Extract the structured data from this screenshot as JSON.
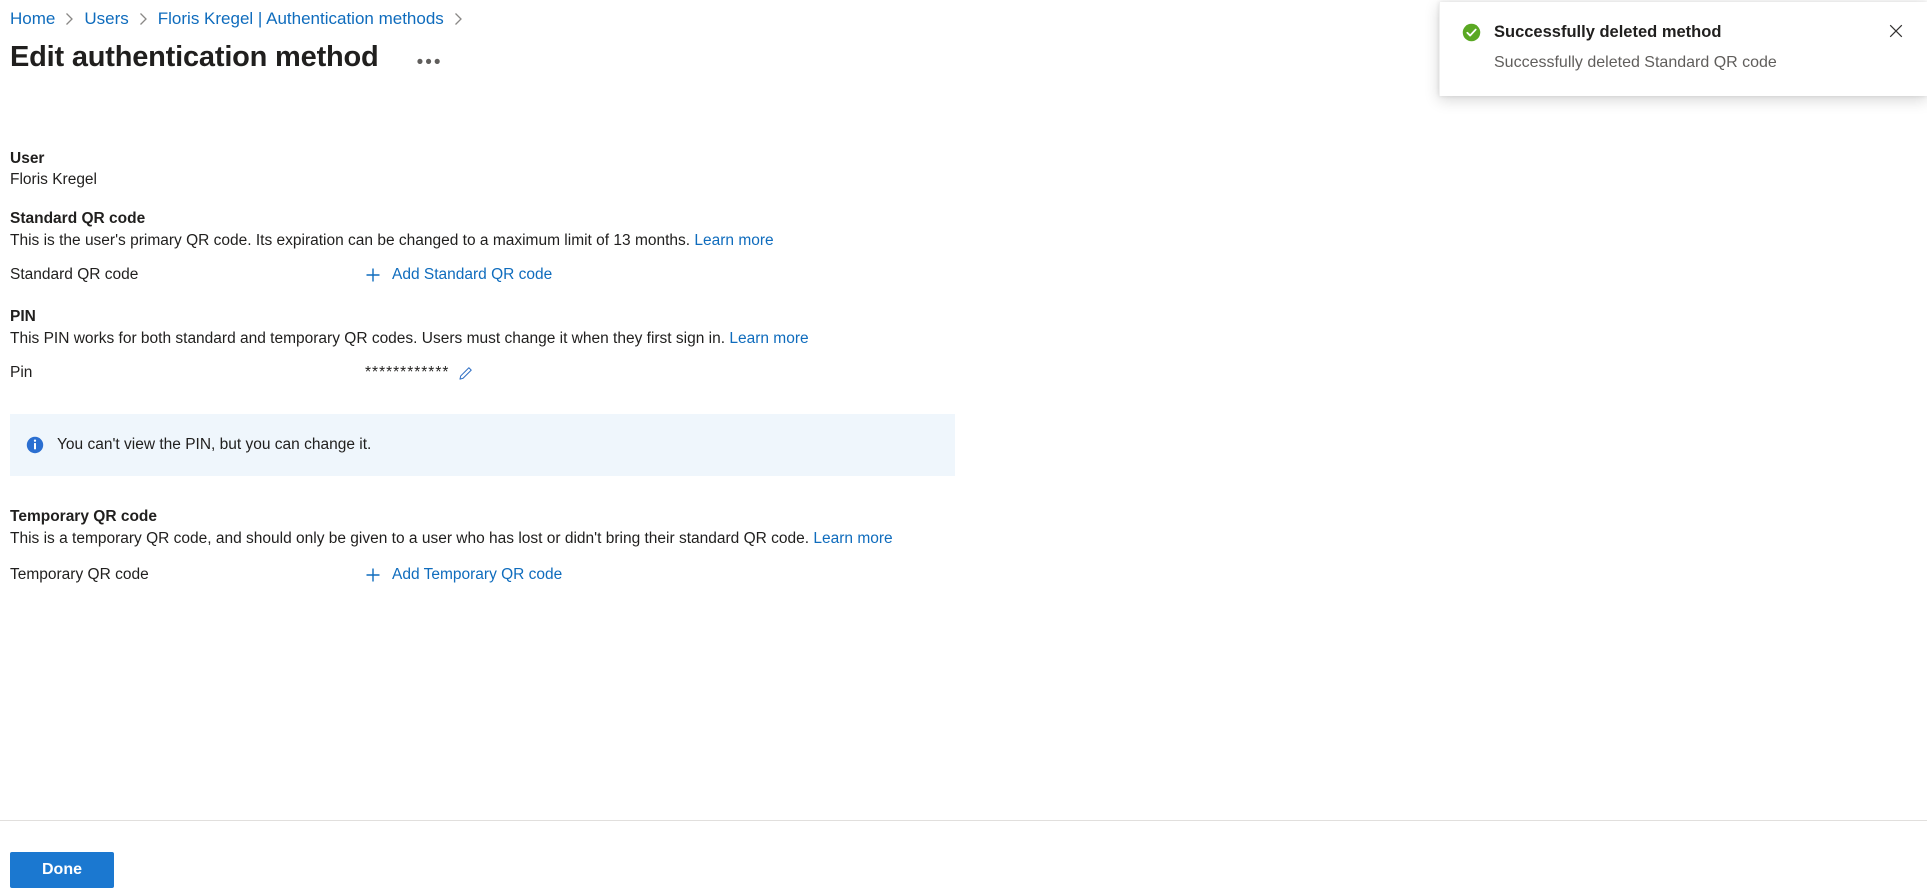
{
  "breadcrumb": {
    "items": [
      {
        "label": "Home"
      },
      {
        "label": "Users"
      },
      {
        "label": "Floris Kregel | Authentication methods"
      }
    ],
    "separator_icon": "chevron-right-icon"
  },
  "header": {
    "title": "Edit authentication method",
    "more_label": "•••",
    "more_icon": "ellipsis-icon"
  },
  "user_section": {
    "label": "User",
    "value": "Floris Kregel"
  },
  "standard_qr": {
    "heading": "Standard QR code",
    "description": "This is the user's primary QR code. Its expiration can be changed to a maximum limit of 13 months.",
    "learn_more": "Learn more",
    "row_label": "Standard QR code",
    "add_label": "Add Standard QR code",
    "add_icon": "plus-icon"
  },
  "pin_section": {
    "heading": "PIN",
    "description": "This PIN works for both standard and temporary QR codes. Users must change it when they first sign in.",
    "learn_more": "Learn more",
    "row_label": "Pin",
    "masked_value": "************",
    "edit_icon": "pencil-icon"
  },
  "info_banner": {
    "icon": "info-icon",
    "text": "You can't view the PIN, but you can change it.",
    "background_color": "#eff6fc",
    "icon_color": "#0f6cbd"
  },
  "temporary_qr": {
    "heading": "Temporary QR code",
    "description": "This is a temporary QR code, and should only be given to a user who has lost or didn't bring their standard QR code.",
    "learn_more": "Learn more",
    "row_label": "Temporary QR code",
    "add_label": "Add Temporary QR code",
    "add_icon": "plus-icon"
  },
  "footer": {
    "done_label": "Done",
    "done_color": "#1b78d0"
  },
  "toast": {
    "status_icon": "success-check-icon",
    "title": "Successfully deleted method",
    "message": "Successfully deleted Standard QR code",
    "close_icon": "close-icon",
    "accent_color": "#57a300"
  },
  "colors": {
    "link": "#0f6cbd",
    "text": "#201f1e",
    "secondary_text": "#605e5c",
    "divider": "#e1dfdd"
  }
}
